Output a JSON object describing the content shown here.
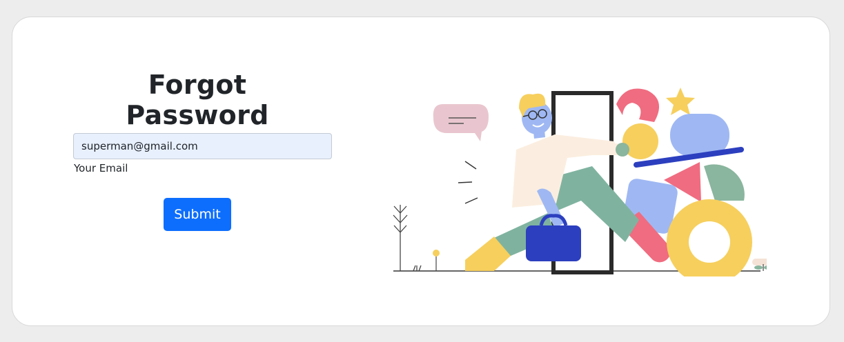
{
  "form": {
    "title": "Forgot Password",
    "email_value": "superman@gmail.com",
    "email_label": "Your Email",
    "submit_label": "Submit"
  },
  "illustration": {
    "icon": "person-walking-through-door-illustration"
  },
  "colors": {
    "page_background": "#ededed",
    "card_background": "#ffffff",
    "input_background": "#e8f0fe",
    "button_primary": "#0d6efd",
    "text_dark": "#212529"
  }
}
